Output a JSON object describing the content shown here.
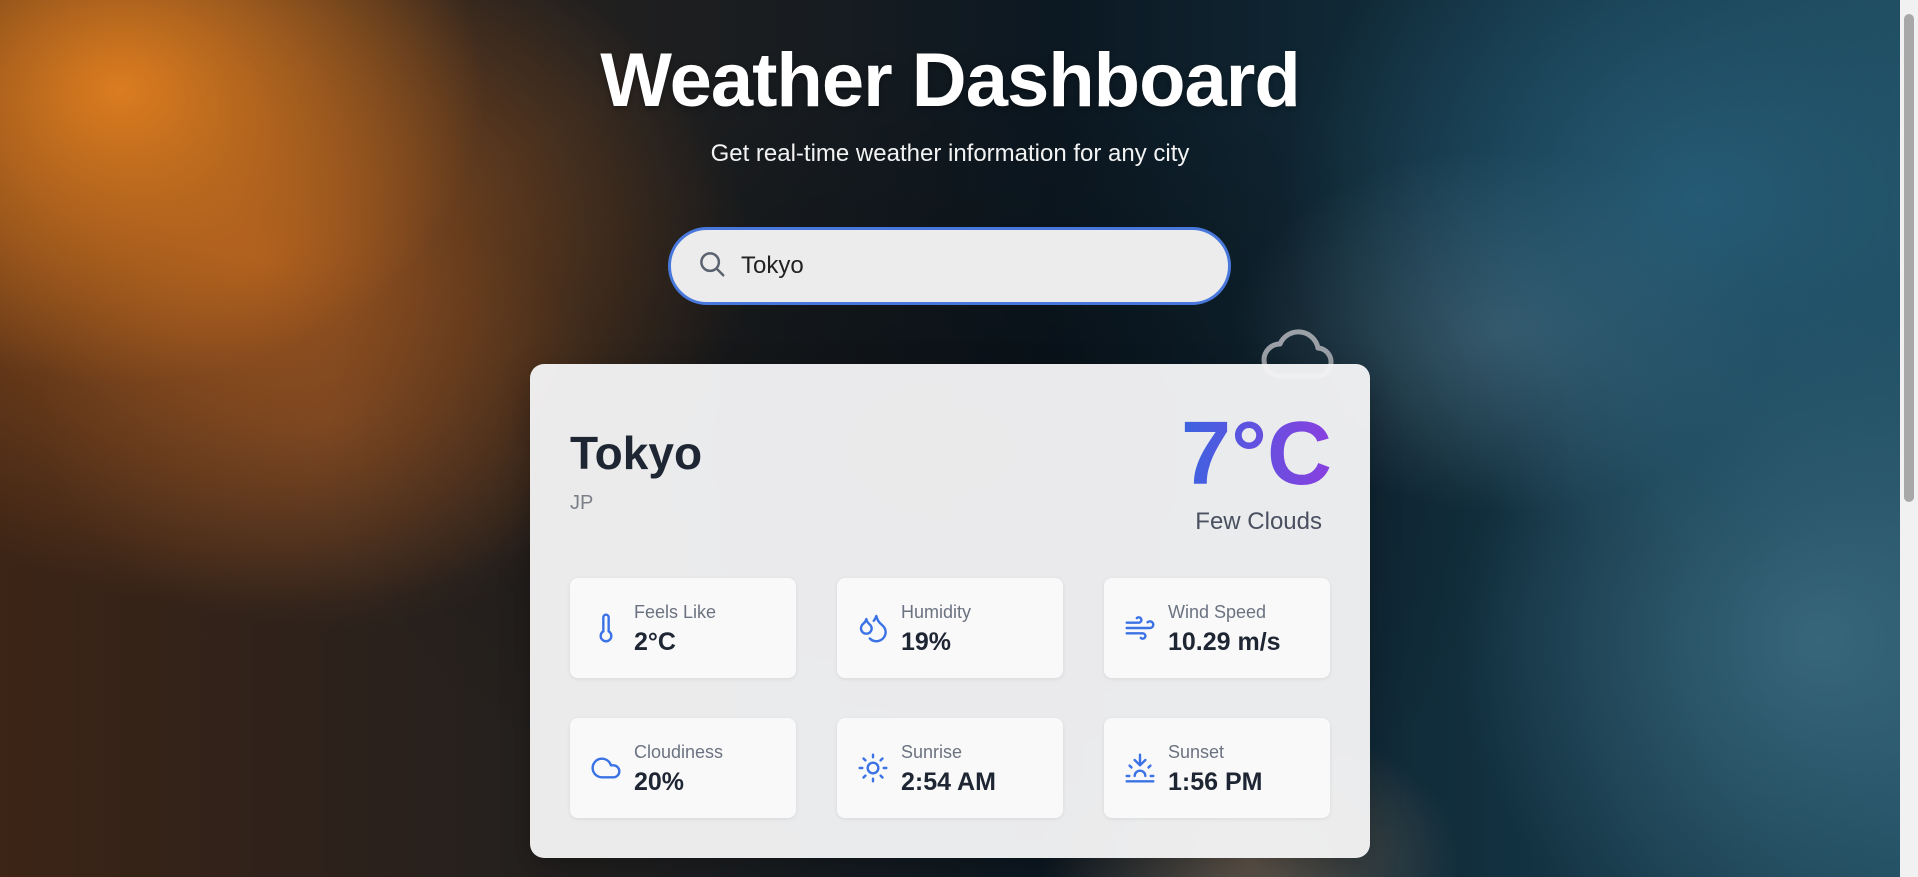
{
  "header": {
    "title": "Weather Dashboard",
    "subtitle": "Get real-time weather information for any city"
  },
  "search": {
    "value": "Tokyo",
    "icon": "search-icon"
  },
  "weather": {
    "city": "Tokyo",
    "country": "JP",
    "temperature": "7°C",
    "condition": "Few Clouds",
    "condition_icon": "cloud-icon",
    "stats": [
      {
        "label": "Feels Like",
        "value": "2°C",
        "icon": "thermometer-icon"
      },
      {
        "label": "Humidity",
        "value": "19%",
        "icon": "droplets-icon"
      },
      {
        "label": "Wind Speed",
        "value": "10.29 m/s",
        "icon": "wind-icon"
      },
      {
        "label": "Cloudiness",
        "value": "20%",
        "icon": "cloud-icon"
      },
      {
        "label": "Sunrise",
        "value": "2:54 AM",
        "icon": "sun-icon"
      },
      {
        "label": "Sunset",
        "value": "1:56 PM",
        "icon": "sunset-icon"
      }
    ]
  },
  "colors": {
    "accent": "#4878dc",
    "icon": "#3b73e6",
    "temp_gradient_start": "#3b63e0",
    "temp_gradient_end": "#8a3fe0"
  }
}
